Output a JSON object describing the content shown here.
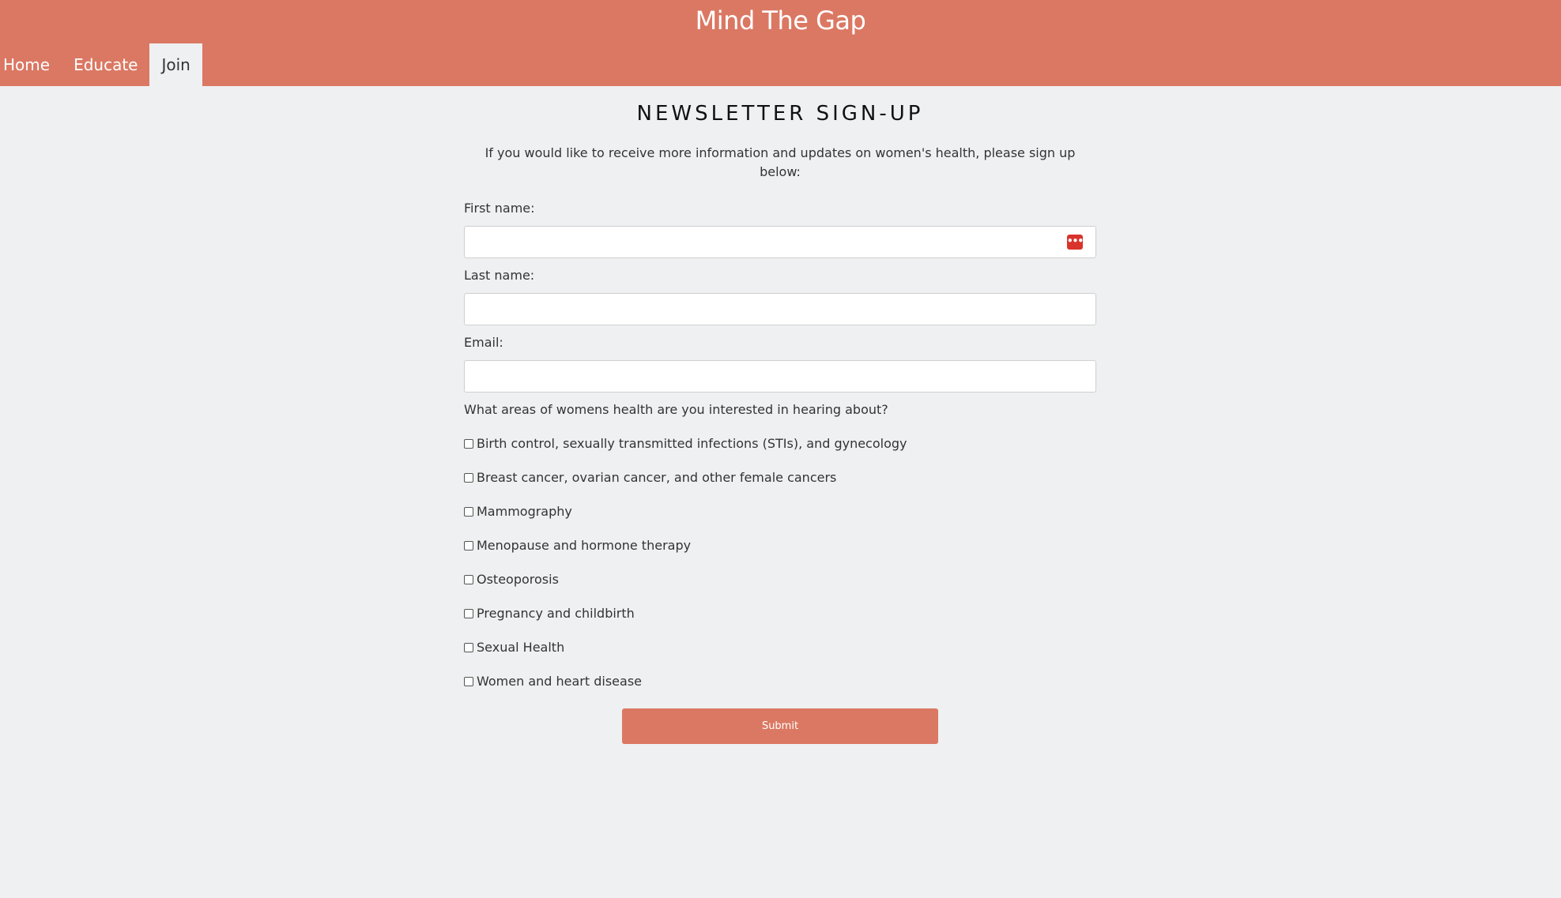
{
  "header": {
    "site_title": "Mind The Gap",
    "nav": [
      {
        "label": "Home",
        "active": false
      },
      {
        "label": "Educate",
        "active": false
      },
      {
        "label": "Join",
        "active": true
      }
    ]
  },
  "main": {
    "heading": "NEWSLETTER SIGN-UP",
    "intro": "If you would like to receive more information and updates on women's health, please sign up below:",
    "fields": {
      "first_name": {
        "label": "First name:",
        "value": ""
      },
      "last_name": {
        "label": "Last name:",
        "value": ""
      },
      "email": {
        "label": "Email:",
        "value": ""
      }
    },
    "autofill_icon": "password-manager-icon",
    "question": "What areas of womens health are you interested in hearing about?",
    "options": [
      {
        "label": "Birth control, sexually transmitted infections (STIs), and gynecology",
        "checked": false
      },
      {
        "label": "Breast cancer, ovarian cancer, and other female cancers",
        "checked": false
      },
      {
        "label": "Mammography",
        "checked": false
      },
      {
        "label": "Menopause and hormone therapy",
        "checked": false
      },
      {
        "label": "Osteoporosis",
        "checked": false
      },
      {
        "label": "Pregnancy and childbirth",
        "checked": false
      },
      {
        "label": "Sexual Health",
        "checked": false
      },
      {
        "label": "Women and heart disease",
        "checked": false
      }
    ],
    "submit_label": "Submit"
  },
  "colors": {
    "brand": "#db7863",
    "background": "#eff0f1",
    "autofill": "#d9342b"
  }
}
